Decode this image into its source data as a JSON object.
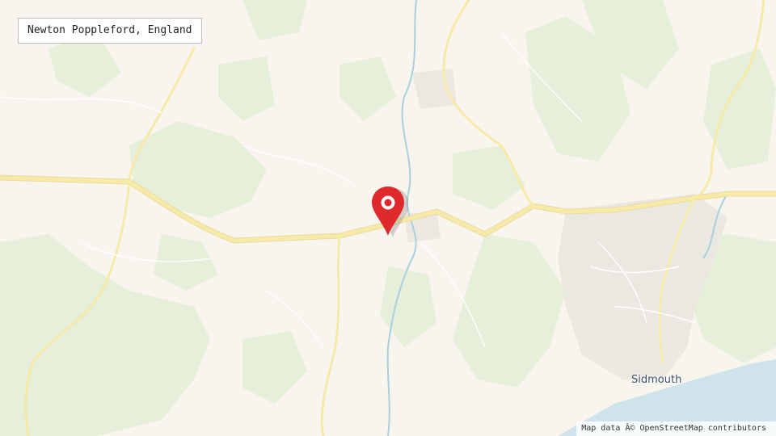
{
  "map": {
    "place_label": "Newton Poppleford, England",
    "town_label": "Sidmouth",
    "attribution": "Map data Â© OpenStreetMap contributors",
    "marker_icon": "map-pin-icon"
  },
  "colors": {
    "land": "#f8f5ef",
    "woodland": "#e6efd9",
    "road": "#f7e9a8",
    "road_casing": "#eadca0",
    "water": "#cfe4ea",
    "river": "#a9d0dc",
    "urban": "#ebe8e2",
    "marker": "#e0292d"
  }
}
